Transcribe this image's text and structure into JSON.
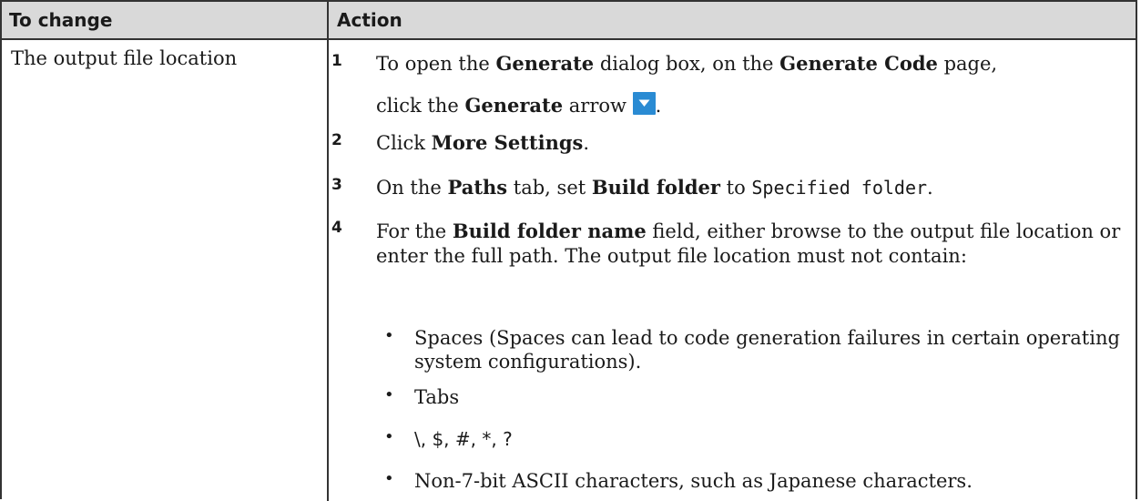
{
  "table": {
    "headers": {
      "col1": "To change",
      "col2": "Action"
    },
    "row": {
      "label": "The output file location",
      "steps": [
        {
          "num": "1",
          "parts": [
            "To open the ",
            "Generate",
            " dialog box, on the ",
            "Generate Code",
            " page,"
          ],
          "line2": [
            "click the ",
            "Generate",
            " arrow ",
            "."
          ]
        },
        {
          "num": "2",
          "parts": [
            "Click ",
            "More Settings",
            "."
          ]
        },
        {
          "num": "3",
          "parts": [
            "On the ",
            "Paths",
            " tab, set ",
            "Build folder",
            " to ",
            "Specified folder",
            "."
          ]
        },
        {
          "num": "4",
          "parts": [
            "For the ",
            "Build folder name",
            " field, either browse to the output file location or enter the full path. The output file location must not contain:"
          ]
        }
      ],
      "bullets": [
        "Spaces (Spaces can lead to code generation failures in certain operating system configurations).",
        "Tabs",
        "\\, $, #, *, ?",
        "Non-7-bit ASCII characters, such as Japanese characters."
      ],
      "bullet_marker": "•",
      "arrow_icon": "dropdown-arrow-icon",
      "arrow_color": "#2a8bd3"
    }
  }
}
